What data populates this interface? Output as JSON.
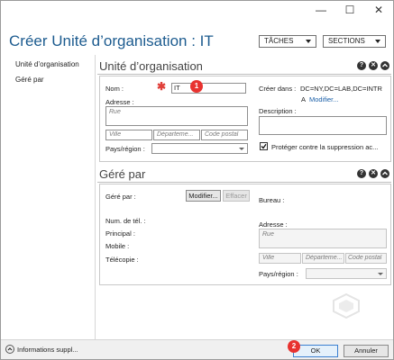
{
  "window": {
    "controls": [
      "—",
      "☐",
      "✕"
    ]
  },
  "header": {
    "title": "Créer Unité d’organisation : IT",
    "tasks_label": "TÂCHES",
    "sections_label": "SECTIONS"
  },
  "sidebar": {
    "items": [
      {
        "label": "Unité d’organisation"
      },
      {
        "label": "Géré par"
      }
    ]
  },
  "ou_section": {
    "title": "Unité d’organisation",
    "name_label": "Nom :",
    "name_value": "IT",
    "address_label": "Adresse :",
    "street_placeholder": "Rue",
    "city_placeholder": "Ville",
    "dept_placeholder": "Départeme...",
    "postal_placeholder": "Code postal",
    "country_label": "Pays/région :",
    "create_in_label": "Créer dans :",
    "create_in_value": "DC=NY,DC=LAB,DC=INTR",
    "create_in_tail": "A",
    "modify_link": "Modifier...",
    "description_label": "Description :",
    "protect_label": "Protéger contre la suppression ac...",
    "protect_checked": true
  },
  "managed_section": {
    "title": "Géré par",
    "managed_by_label": "Géré par :",
    "modify_button": "Modifier...",
    "clear_button": "Effacer",
    "office_label": "Bureau :",
    "phone_label": "Num. de tél. :",
    "main_label": "Principal :",
    "mobile_label": "Mobile :",
    "fax_label": "Télécopie :",
    "address_label": "Adresse :",
    "street_placeholder": "Rue",
    "city_placeholder": "Ville",
    "dept_placeholder": "Départeme...",
    "postal_placeholder": "Code postal",
    "country_label": "Pays/région :"
  },
  "footer": {
    "more_info": "Informations suppl...",
    "ok": "OK",
    "cancel": "Annuler"
  },
  "callouts": {
    "one": "1",
    "two": "2"
  },
  "colors": {
    "title_blue": "#1c5b8f",
    "callout_red": "#e8322f"
  }
}
